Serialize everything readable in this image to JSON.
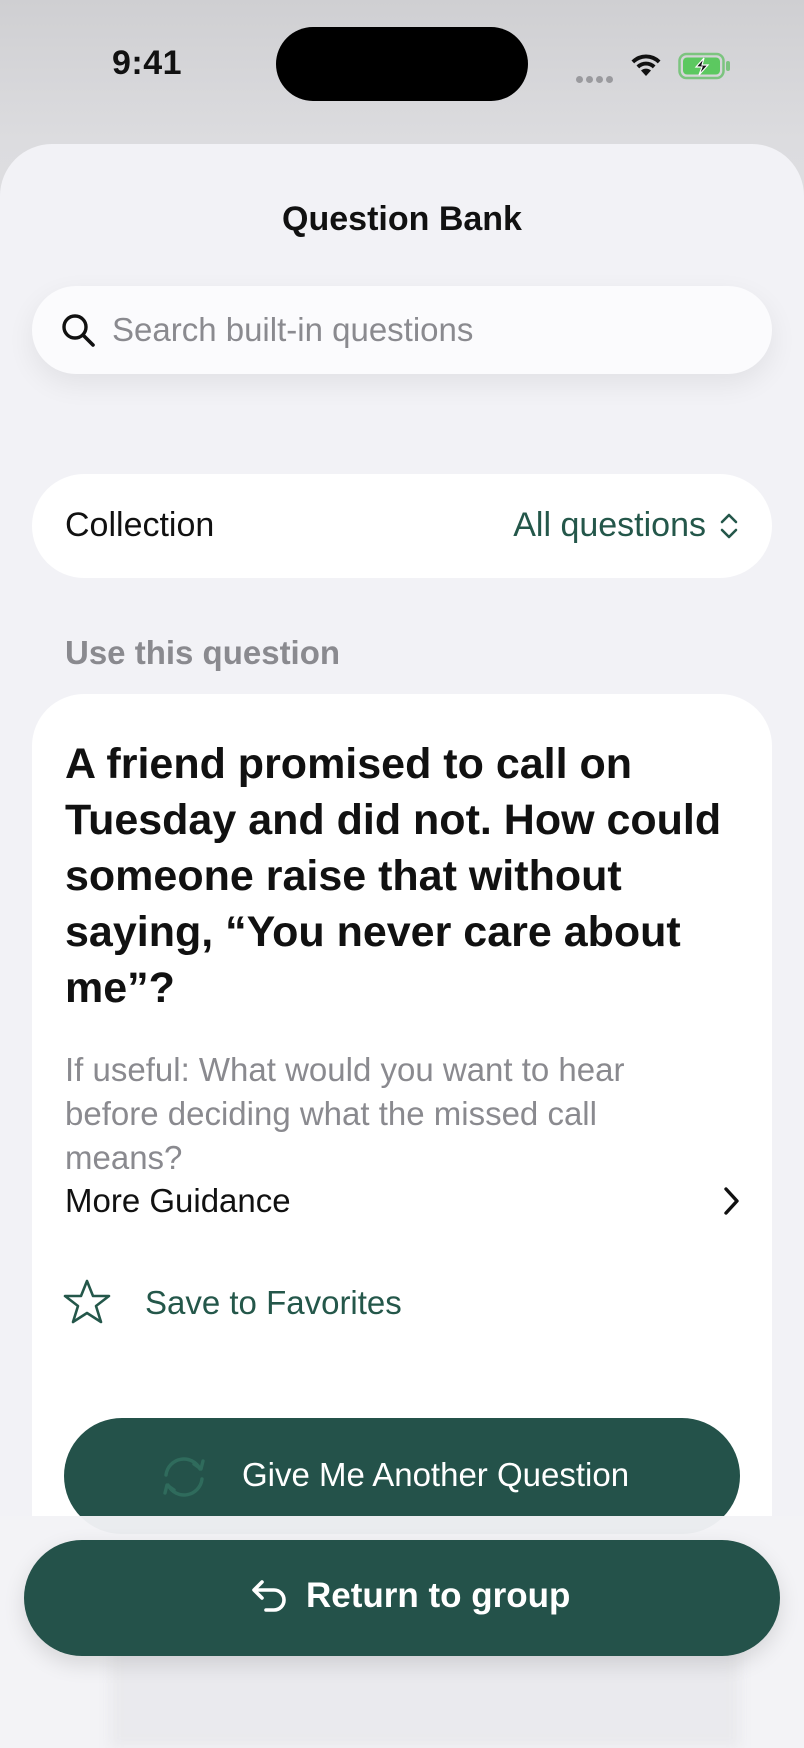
{
  "status_bar": {
    "time": "9:41"
  },
  "sheet": {
    "title": "Question Bank"
  },
  "search": {
    "placeholder": "Search built-in questions"
  },
  "collection": {
    "label": "Collection",
    "value": "All questions"
  },
  "section": {
    "label": "Use this question"
  },
  "question_card": {
    "question": "A friend promised to call on Tuesday and did not. How could someone raise that without saying, “You never care about me”?",
    "hint": "If useful: What would you want to hear before deciding what the missed call means?",
    "guidance_label": "More Guidance",
    "favorites_label": "Save to Favorites",
    "another_label": "Give Me Another Question"
  },
  "footer": {
    "return_label": "Return to group"
  },
  "colors": {
    "accent": "#24524a",
    "accent_text": "#24574a",
    "secondary_text": "#8a8a8f",
    "sheet_bg": "#f2f2f6"
  },
  "icons": [
    "search-icon",
    "chevron-up-down-icon",
    "chevron-right-icon",
    "star-icon",
    "refresh-icon",
    "return-arrow-icon",
    "wifi-icon",
    "battery-icon"
  ]
}
